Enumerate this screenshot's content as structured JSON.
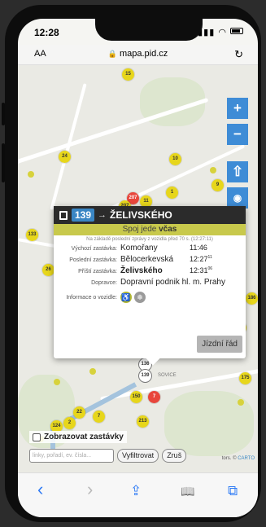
{
  "status_bar": {
    "time": "12:28"
  },
  "browser": {
    "text_size_label": "AA",
    "url": "mapa.pid.cz"
  },
  "map": {
    "stop_markers": [
      {
        "label": "15",
        "variant": "yellow"
      },
      {
        "label": "24",
        "variant": "yellow"
      },
      {
        "label": "10",
        "variant": "yellow"
      },
      {
        "label": "9",
        "variant": "yellow"
      },
      {
        "label": "11",
        "variant": "yellow"
      },
      {
        "label": "207",
        "variant": "red"
      },
      {
        "label": "207",
        "variant": "yellow"
      },
      {
        "label": "133",
        "variant": "yellow"
      },
      {
        "label": "1",
        "variant": "yellow"
      },
      {
        "label": "26",
        "variant": "yellow"
      },
      {
        "label": "186",
        "variant": "yellow"
      },
      {
        "label": "26",
        "variant": "yellow"
      },
      {
        "label": "136",
        "variant": "white"
      },
      {
        "label": "139",
        "variant": "white"
      },
      {
        "label": "175",
        "variant": "yellow"
      },
      {
        "label": "150",
        "variant": "yellow"
      },
      {
        "label": "7",
        "variant": "red"
      },
      {
        "label": "213",
        "variant": "yellow"
      },
      {
        "label": "22",
        "variant": "yellow"
      },
      {
        "label": "7",
        "variant": "yellow"
      },
      {
        "label": "124",
        "variant": "yellow"
      },
      {
        "label": "2",
        "variant": "yellow"
      }
    ],
    "district_label": "SOVICE"
  },
  "map_controls": {
    "zoom_in": "+",
    "zoom_out": "−",
    "locate_up": "⇧",
    "my_location": "◉"
  },
  "popup": {
    "line": "139",
    "arrow": "→",
    "destination": "ŽELIVSKÉHO",
    "status_prefix": "Spoj jede",
    "status_value": "včas",
    "note": "Na základě poslední zprávy z vozidla před 70 s. (12:27:11)",
    "rows": [
      {
        "label": "Výchozí zastávka:",
        "value": "Komořany",
        "time": "11:46",
        "sup": ""
      },
      {
        "label": "Poslední zastávka:",
        "value": "Bělocerkevská",
        "time": "12:27",
        "sup": "11"
      },
      {
        "label": "Příští zastávka:",
        "value": "Želivského",
        "time": "12:31",
        "sup": "06"
      }
    ],
    "operator_label": "Dopravce:",
    "operator_value": "Dopravní podnik hl. m. Prahy",
    "vehicle_info_label": "Informace o vozidle:",
    "vehicle_icons": [
      "wheelchair-icon",
      "air-conditioning-icon"
    ],
    "timetable_button": "Jízdní řád"
  },
  "filter": {
    "show_stops_label": "Zobrazovat zastávky",
    "input_placeholder": "linky, pořadí, ev. čísla...",
    "filter_button": "Vyfiltrovat",
    "cancel_button": "Zruš",
    "attribution_prefix": "tors. ©",
    "attribution_link": "CARTO"
  },
  "toolbar": {
    "back": "‹",
    "forward": "›",
    "share": "⇪",
    "bookmarks": "📖",
    "tabs": "⧉"
  }
}
